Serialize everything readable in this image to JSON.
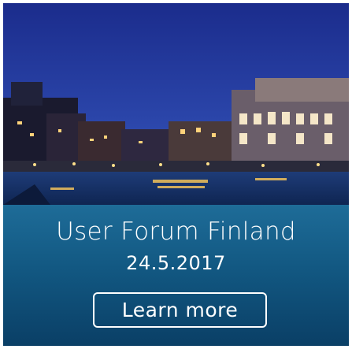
{
  "banner": {
    "title": "User Forum Finland",
    "date": "24.5.2017",
    "cta_label": "Learn more",
    "image_description_icon": "night-harbor-cityscape-image"
  },
  "colors": {
    "overlay_top": "#1e6c98",
    "overlay_bottom": "#0a3f66",
    "text": "#ffffff",
    "sky": "#1a2f8f"
  }
}
